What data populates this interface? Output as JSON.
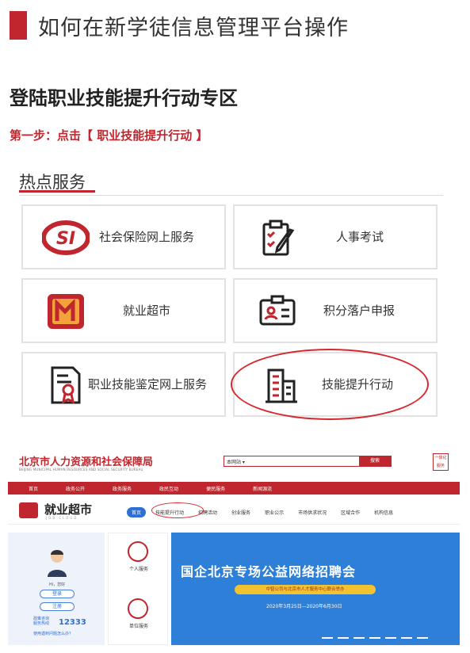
{
  "header": {
    "title": "如何在新学徒信息管理平台操作"
  },
  "section": {
    "heading": "登陆职业技能提升行动专区"
  },
  "step": {
    "text": "第一步：点击【 职业技能提升行动 】"
  },
  "hot_services": {
    "title": "热点服务",
    "items": [
      {
        "label": "社会保险网上服务",
        "icon": "si-logo-icon"
      },
      {
        "label": "人事考试",
        "icon": "exam-clipboard-icon"
      },
      {
        "label": "就业超市",
        "icon": "employment-logo-icon"
      },
      {
        "label": "积分落户申报",
        "icon": "id-card-icon"
      },
      {
        "label": "职业技能鉴定网上服务",
        "icon": "certificate-icon"
      },
      {
        "label": "技能提升行动",
        "icon": "building-icon"
      }
    ]
  },
  "website": {
    "org_name": "北京市人力资源和社会保障局",
    "org_sub": "BEIJING MUNICIPAL HUMAN RESOURCES AND SOCIAL SECURITY BUREAU",
    "search_select": "本网站",
    "search_button": "搜索",
    "emblem_text": "一体化 服务",
    "nav": [
      "首页",
      "政务公开",
      "政务服务",
      "政民互动",
      "便民服务",
      "新闻源流"
    ],
    "jiuye_title": "就业超市",
    "jiuye_sub": "JOB CLOUD",
    "tabs": [
      "首页",
      "技能提升行动",
      "招聘活动",
      "创业服务",
      "职业公示",
      "市场供求状况",
      "区域合作",
      "机构信息"
    ],
    "greeting": "Hi，您好",
    "login": "登录",
    "register": "注册",
    "hotline_label1": "政策咨询",
    "hotline_label2": "服务热线",
    "hotline_number": "12333",
    "help": "使用遇到问题怎么办？",
    "mid_items": [
      "个人服务",
      "单位服务"
    ],
    "banner_title": "国企北京专场公益网络招聘会",
    "banner_pill": "中智公司与北京市人才服务中心联合举办",
    "banner_date": "2020年3月25日—2020年6月30日"
  }
}
